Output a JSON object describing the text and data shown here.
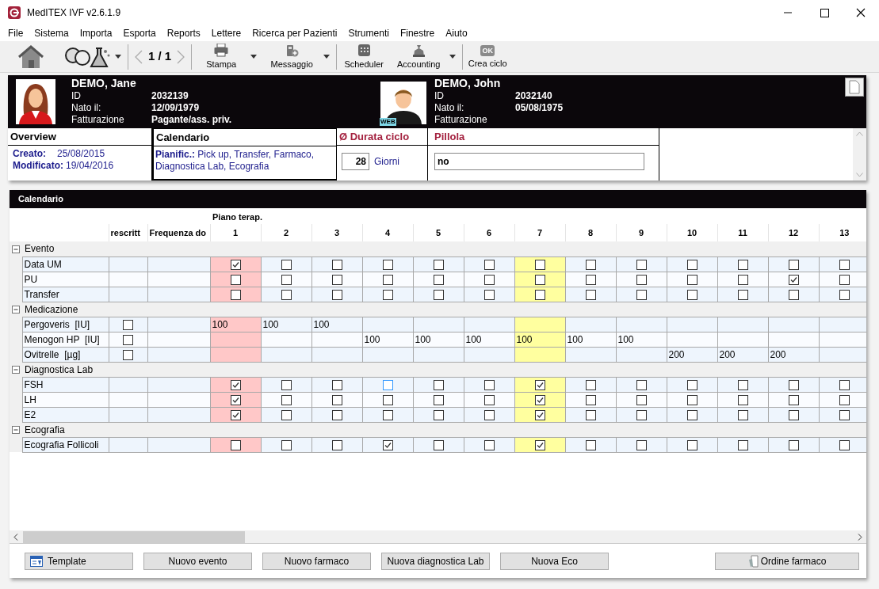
{
  "window": {
    "title": "MedITEX IVF v2.6.1.9"
  },
  "menu": [
    "File",
    "Sistema",
    "Importa",
    "Esporta",
    "Reports",
    "Lettere",
    "Ricerca per Pazienti",
    "Strumenti",
    "Finestre",
    "Aiuto"
  ],
  "toolbar": {
    "pager": "1 / 1",
    "buttons": [
      {
        "label": "Stampa",
        "dropdown": true
      },
      {
        "label": "Messaggio",
        "dropdown": true
      },
      {
        "label": "Scheduler",
        "dropdown": false
      },
      {
        "label": "Accounting",
        "dropdown": true
      },
      {
        "label": "Crea ciclo",
        "dropdown": false,
        "badge": "OK"
      }
    ]
  },
  "patients": [
    {
      "kind": "female",
      "name": "DEMO, Jane",
      "fields": [
        {
          "label": "ID",
          "value": "2032139"
        },
        {
          "label": "Nato il:",
          "value": "12/09/1979"
        },
        {
          "label": "Fatturazione",
          "value": "Pagante/ass. priv."
        }
      ]
    },
    {
      "kind": "male",
      "name": "DEMO, John",
      "badge": "WEB",
      "fields": [
        {
          "label": "ID",
          "value": "2032140"
        },
        {
          "label": "Nato il:",
          "value": "05/08/1975"
        },
        {
          "label": "Fatturazione"
        }
      ]
    }
  ],
  "overview": {
    "title": "Overview",
    "lines": [
      {
        "label": "Creato:",
        "value": "25/08/2015"
      },
      {
        "label": "Modificato:",
        "value": "19/04/2016"
      }
    ]
  },
  "calendar_summary": {
    "title": "Calendario",
    "text": "**Pianific.:** Pick up, Transfer, Farmaco, Diagnostica Lab, Ecografia"
  },
  "cycle_length": {
    "title": "Ø Durata ciclo",
    "value": "28",
    "unit": "Giorni"
  },
  "pill": {
    "title": "Pillola",
    "value": "no"
  },
  "calendar": {
    "title": "Calendario",
    "plan_header": "Piano terap.",
    "columns": [
      "rescritt",
      "Frequenza do"
    ],
    "days": [
      {
        "label": "1",
        "color": "#ffc8c8"
      },
      {
        "label": "2"
      },
      {
        "label": "3"
      },
      {
        "label": "4"
      },
      {
        "label": "5"
      },
      {
        "label": "6"
      },
      {
        "label": "7",
        "color": "#ffff9f"
      },
      {
        "label": "8"
      },
      {
        "label": "9"
      },
      {
        "label": "10"
      },
      {
        "label": "11"
      },
      {
        "label": "12"
      },
      {
        "label": "13"
      }
    ],
    "groups": [
      {
        "name": "Evento",
        "expanded": true,
        "rows": [
          {
            "kind": "check",
            "label": "Data UM",
            "cells": [
              {
                "checked": true,
                "focused": false
              },
              {
                "checked": false,
                "focused": false
              },
              {
                "checked": false,
                "focused": false
              },
              {
                "checked": false,
                "focused": false
              },
              {
                "checked": false,
                "focused": false
              },
              {
                "checked": false,
                "focused": false
              },
              {
                "checked": false,
                "focused": false
              },
              {
                "checked": false,
                "focused": false
              },
              {
                "checked": false,
                "focused": false
              },
              {
                "checked": false,
                "focused": false
              },
              {
                "checked": false,
                "focused": false
              },
              {
                "checked": false,
                "focused": false
              },
              {
                "checked": false,
                "focused": false
              }
            ]
          },
          {
            "kind": "check",
            "label": "PU",
            "cells": [
              {
                "checked": false,
                "focused": false
              },
              {
                "checked": false,
                "focused": false
              },
              {
                "checked": false,
                "focused": false
              },
              {
                "checked": false,
                "focused": false
              },
              {
                "checked": false,
                "focused": false
              },
              {
                "checked": false,
                "focused": false
              },
              {
                "checked": false,
                "focused": false
              },
              {
                "checked": false,
                "focused": false
              },
              {
                "checked": false,
                "focused": false
              },
              {
                "checked": false,
                "focused": false
              },
              {
                "checked": false,
                "focused": false
              },
              {
                "checked": true,
                "focused": false
              },
              {
                "checked": false,
                "focused": false
              }
            ]
          },
          {
            "kind": "check",
            "label": "Transfer",
            "cells": [
              {
                "checked": false,
                "focused": false
              },
              {
                "checked": false,
                "focused": false
              },
              {
                "checked": false,
                "focused": false
              },
              {
                "checked": false,
                "focused": false
              },
              {
                "checked": false,
                "focused": false
              },
              {
                "checked": false,
                "focused": false
              },
              {
                "checked": false,
                "focused": false
              },
              {
                "checked": false,
                "focused": false
              },
              {
                "checked": false,
                "focused": false
              },
              {
                "checked": false,
                "focused": false
              },
              {
                "checked": false,
                "focused": false
              },
              {
                "checked": false,
                "focused": false
              },
              {
                "checked": false,
                "focused": false
              }
            ]
          }
        ]
      },
      {
        "name": "Medicazione",
        "expanded": true,
        "rows": [
          {
            "kind": "dose",
            "label": "Pergoveris  [IU]",
            "prescribed": false,
            "cells": [
              "100",
              "100",
              "100",
              null,
              null,
              null,
              null,
              null,
              null,
              null,
              null,
              null,
              null
            ]
          },
          {
            "kind": "dose",
            "label": "Menogon HP  [IU]",
            "prescribed": false,
            "cells": [
              null,
              null,
              null,
              "100",
              "100",
              "100",
              "100",
              "100",
              "100",
              null,
              null,
              null,
              null
            ]
          },
          {
            "kind": "dose",
            "label": "Ovitrelle  [µg]",
            "prescribed": false,
            "cells": [
              null,
              null,
              null,
              null,
              null,
              null,
              null,
              null,
              null,
              "200",
              "200",
              "200",
              null
            ]
          }
        ]
      },
      {
        "name": "Diagnostica Lab",
        "expanded": true,
        "rows": [
          {
            "kind": "check",
            "label": "FSH",
            "cells": [
              {
                "checked": true,
                "focused": false
              },
              {
                "checked": false,
                "focused": false
              },
              {
                "checked": false,
                "focused": false
              },
              {
                "checked": false,
                "focused": true
              },
              {
                "checked": false,
                "focused": false
              },
              {
                "checked": false,
                "focused": false
              },
              {
                "checked": true,
                "focused": false
              },
              {
                "checked": false,
                "focused": false
              },
              {
                "checked": false,
                "focused": false
              },
              {
                "checked": false,
                "focused": false
              },
              {
                "checked": false,
                "focused": false
              },
              {
                "checked": false,
                "focused": false
              },
              {
                "checked": false,
                "focused": false
              }
            ]
          },
          {
            "kind": "check",
            "label": "LH",
            "cells": [
              {
                "checked": true,
                "focused": false
              },
              {
                "checked": false,
                "focused": false
              },
              {
                "checked": false,
                "focused": false
              },
              {
                "checked": false,
                "focused": false
              },
              {
                "checked": false,
                "focused": false
              },
              {
                "checked": false,
                "focused": false
              },
              {
                "checked": true,
                "focused": false
              },
              {
                "checked": false,
                "focused": false
              },
              {
                "checked": false,
                "focused": false
              },
              {
                "checked": false,
                "focused": false
              },
              {
                "checked": false,
                "focused": false
              },
              {
                "checked": false,
                "focused": false
              },
              {
                "checked": false,
                "focused": false
              }
            ]
          },
          {
            "kind": "check",
            "label": "E2",
            "cells": [
              {
                "checked": true,
                "focused": false
              },
              {
                "checked": false,
                "focused": false
              },
              {
                "checked": false,
                "focused": false
              },
              {
                "checked": false,
                "focused": false
              },
              {
                "checked": false,
                "focused": false
              },
              {
                "checked": false,
                "focused": false
              },
              {
                "checked": true,
                "focused": false
              },
              {
                "checked": false,
                "focused": false
              },
              {
                "checked": false,
                "focused": false
              },
              {
                "checked": false,
                "focused": false
              },
              {
                "checked": false,
                "focused": false
              },
              {
                "checked": false,
                "focused": false
              },
              {
                "checked": false,
                "focused": false
              }
            ]
          }
        ]
      },
      {
        "name": "Ecografia",
        "expanded": true,
        "rows": [
          {
            "kind": "check",
            "label": "Ecografia Follicoli",
            "cells": [
              {
                "checked": false,
                "focused": false
              },
              {
                "checked": false,
                "focused": false
              },
              {
                "checked": false,
                "focused": false
              },
              {
                "checked": true,
                "focused": false
              },
              {
                "checked": false,
                "focused": false
              },
              {
                "checked": false,
                "focused": false
              },
              {
                "checked": true,
                "focused": false
              },
              {
                "checked": false,
                "focused": false
              },
              {
                "checked": false,
                "focused": false
              },
              {
                "checked": false,
                "focused": false
              },
              {
                "checked": false,
                "focused": false
              },
              {
                "checked": false,
                "focused": false
              },
              {
                "checked": false,
                "focused": false
              }
            ]
          }
        ]
      }
    ]
  },
  "actions": [
    {
      "kind": "template",
      "label": "Template"
    },
    {
      "kind": "plain",
      "label": "Nuovo evento"
    },
    {
      "kind": "plain",
      "label": "Nuovo farmaco"
    },
    {
      "kind": "plain",
      "label": "Nuova diagnostica Lab"
    },
    {
      "kind": "plain",
      "label": "Nuova Eco"
    },
    {
      "kind": "order",
      "label": "Ordine farmaco"
    }
  ]
}
